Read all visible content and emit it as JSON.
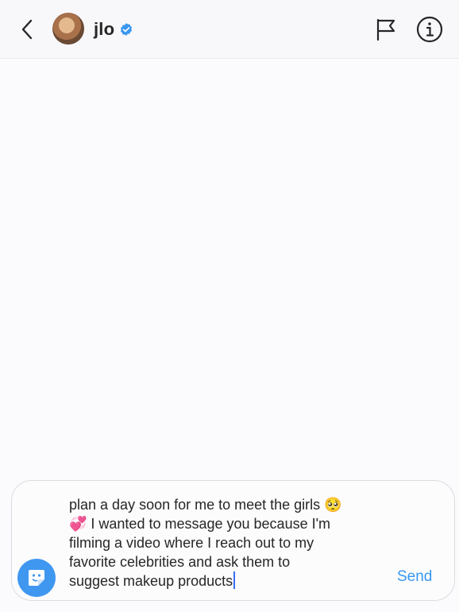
{
  "header": {
    "username": "jlo",
    "verified_color": "#3897f0",
    "icons": [
      "back-arrow-icon",
      "avatar",
      "verified-badge-icon",
      "flag-icon",
      "info-icon"
    ]
  },
  "composer": {
    "message_text": "plan a day soon for me to meet the girls 🥺\n💞 I wanted to message you because I'm\nfilming a video where I reach out to my\nfavorite celebrities and ask them to\nsuggest makeup products",
    "send_label": "Send",
    "sticker_icon": "sticker-icon",
    "accent_color": "#3897f0"
  }
}
